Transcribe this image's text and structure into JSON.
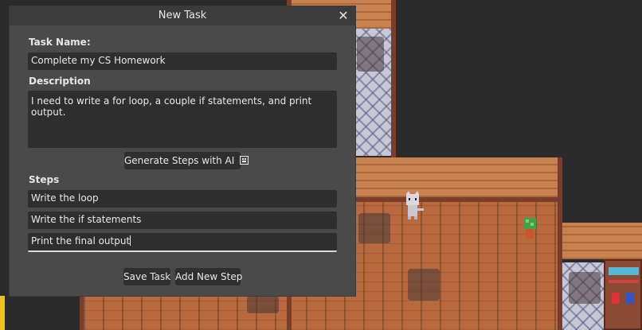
{
  "dialog": {
    "title": "New Task",
    "close_label": "✕",
    "task_name_label": "Task Name:",
    "task_name_value": "Complete my CS Homework",
    "description_label": "Description",
    "description_value": "I need to write a for loop, a couple if statements, and print output.",
    "generate_button_label": "Generate Steps with AI",
    "steps_label": "Steps",
    "steps": [
      "Write the loop",
      "Write the if statements",
      "Print the final output"
    ],
    "save_button_label": "Save Task",
    "add_step_button_label": "Add New Step"
  },
  "colors": {
    "dialog_bg": "#4a4a4a",
    "field_bg": "#2e2e2e",
    "wood_floor": "#b86a3e"
  }
}
